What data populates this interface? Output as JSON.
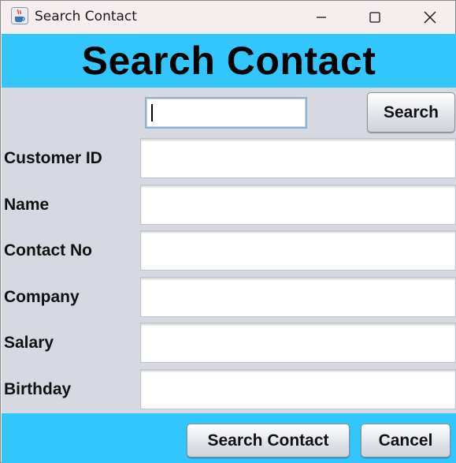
{
  "window": {
    "title": "Search Contact",
    "icon": "java-cup-icon",
    "controls": [
      "minimize-icon",
      "maximize-icon",
      "close-icon"
    ]
  },
  "header": {
    "title": "Search Contact",
    "background": "#33c6fd"
  },
  "search": {
    "value": "",
    "button_label": "Search"
  },
  "fields": [
    {
      "label": "Customer ID",
      "value": ""
    },
    {
      "label": "Name",
      "value": ""
    },
    {
      "label": "Contact No",
      "value": ""
    },
    {
      "label": "Company",
      "value": ""
    },
    {
      "label": "Salary",
      "value": ""
    },
    {
      "label": "Birthday",
      "value": ""
    }
  ],
  "footer": {
    "search_contact_label": "Search Contact",
    "cancel_label": "Cancel"
  }
}
